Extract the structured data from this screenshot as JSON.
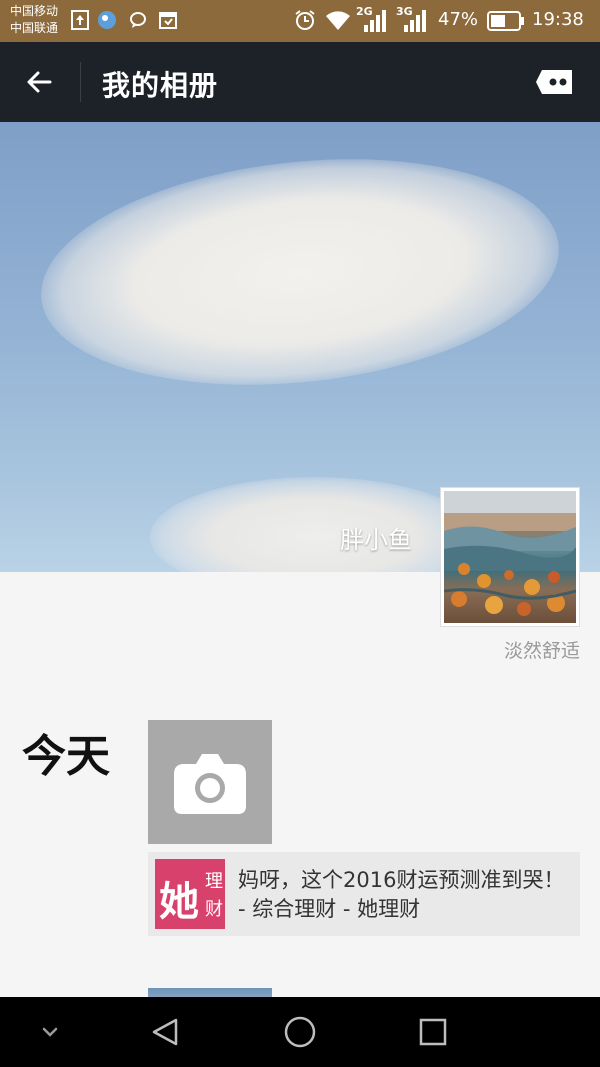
{
  "status_bar": {
    "carrier1": "中国移动",
    "carrier2": "中国联通",
    "net1": "2G",
    "net2": "3G",
    "battery": "47%",
    "time": "19:38"
  },
  "header": {
    "title": "我的相册"
  },
  "profile": {
    "name": "胖小鱼",
    "signature": "淡然舒适"
  },
  "feed": {
    "day_label": "今天",
    "share_title": "妈呀，这个2016财运预测准到哭！ - 综合理财 - 她理财",
    "share_logo_big": "她",
    "share_logo_small1": "理",
    "share_logo_small2": "财"
  },
  "colors": {
    "status_bar_bg": "#8c6a3c",
    "title_bar_bg": "#1c2227",
    "nav_bar_bg": "#000000",
    "logo_accent": "#d9416d"
  },
  "icons": [
    "back-arrow-icon",
    "message-icon",
    "camera-icon",
    "alarm-icon",
    "wifi-icon",
    "signal-icon",
    "battery-icon"
  ]
}
